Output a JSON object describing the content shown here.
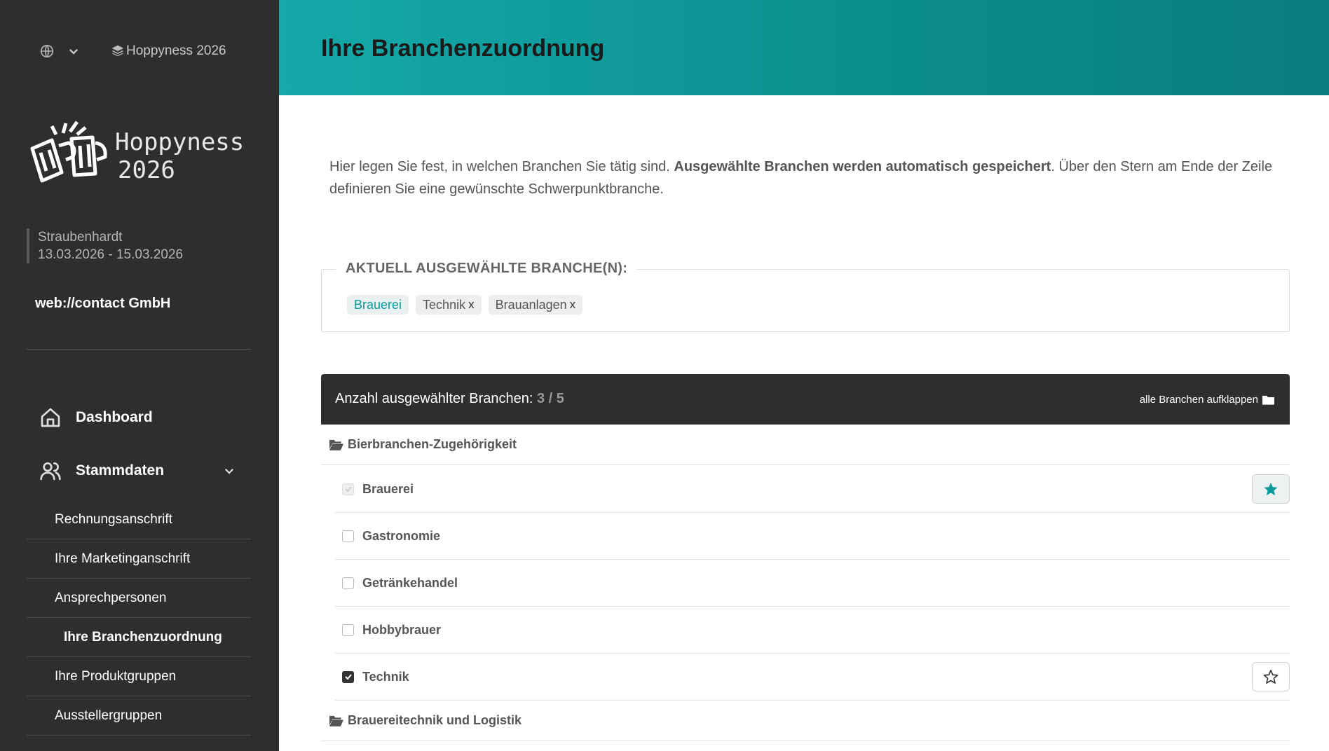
{
  "sidebar": {
    "event_selector": "Hoppyness 2026",
    "logo_text": [
      "Hoppyness",
      "2026"
    ],
    "venue_city": "Straubenhardt",
    "venue_dates": "13.03.2026 - 15.03.2026",
    "company": "web://contact GmbH",
    "nav": {
      "dashboard": "Dashboard",
      "stammdaten": "Stammdaten",
      "sub": [
        "Rechnungsanschrift",
        "Ihre Marketinganschrift",
        "Ansprechpersonen",
        "Ihre Branchenzuordnung",
        "Ihre Produktgruppen",
        "Ausstellergruppen"
      ],
      "active_index": 3
    }
  },
  "header": {
    "title": "Ihre Branchenzuordnung"
  },
  "intro": {
    "part1": "Hier legen Sie fest, in welchen Branchen Sie tätig sind. ",
    "bold": "Ausgewählte Branchen werden automatisch gespeichert",
    "part2": ". Über den Stern am Ende der Zeile definieren Sie eine gewünschte Schwerpunktbranche."
  },
  "selected": {
    "legend": "AKTUELL AUSGEWÄHLTE BRANCHE(N):",
    "chips": [
      {
        "label": "Brauerei",
        "primary": true
      },
      {
        "label": "Technik",
        "remove": "x"
      },
      {
        "label": "Brauanlagen",
        "remove": "x"
      }
    ]
  },
  "panel": {
    "count_label": "Anzahl ausgewählter Branchen: ",
    "count_value": "3 / 5",
    "expand_all": "alle Branchen aufklappen"
  },
  "groups": [
    {
      "name": "Bierbranchen-Zugehörigkeit",
      "items": [
        {
          "label": "Brauerei",
          "checked": true,
          "disabled": true,
          "starred": true
        },
        {
          "label": "Gastronomie",
          "checked": false
        },
        {
          "label": "Getränkehandel",
          "checked": false
        },
        {
          "label": "Hobbybrauer",
          "checked": false
        },
        {
          "label": "Technik",
          "checked": true,
          "starred": false
        }
      ]
    },
    {
      "name": "Brauereitechnik und Logistik",
      "items": []
    }
  ],
  "colors": {
    "accent": "#0b9a9a",
    "sidebar": "#2e2e2e",
    "header_start": "#15a9a9",
    "header_end": "#0a7d7e"
  }
}
